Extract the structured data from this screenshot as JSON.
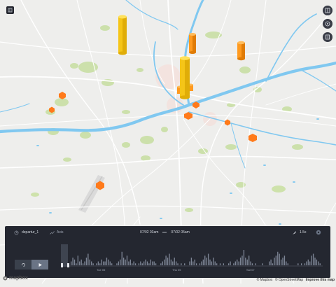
{
  "map": {
    "colors": {
      "land": "#eeeeec",
      "water": "#7cc7ef",
      "park": "#c9dfa4",
      "urban": "#f3d7d2",
      "hex": "#ff7a1a",
      "bar": "#f5c518"
    },
    "columns": [
      {
        "name": "north-tall",
        "height": 0.55,
        "color": "#f5c518"
      },
      {
        "name": "center-tall",
        "height": 0.85,
        "color": "#f5c518"
      },
      {
        "name": "north-short",
        "height": 0.28,
        "color": "#ff9a1f"
      },
      {
        "name": "east",
        "height": 0.25,
        "color": "#ff9a1f"
      },
      {
        "name": "center-small",
        "height": 0.08,
        "color": "#ff9a1f"
      }
    ]
  },
  "controls": {
    "left_icon": "toggle-panel-icon",
    "right_icons": [
      "split-map-icon",
      "layer-visibility-icon",
      "map-legend-icon"
    ]
  },
  "timeline": {
    "filter_field": "departur_1",
    "axis_label": "Axis",
    "range_start": "07/02 03am",
    "range_end": "07/02 05am",
    "speed": "1.5x",
    "ticks": [
      "Tue 05",
      "Thu 05",
      "Sat 07"
    ],
    "loop_icon": "loop-icon",
    "play_icon": "play-icon",
    "histogram": [
      2,
      4,
      3,
      1,
      5,
      2,
      3,
      1,
      2,
      4,
      6,
      3,
      2,
      1,
      0,
      1,
      2,
      1,
      3,
      2,
      2,
      4,
      3,
      2,
      1,
      0,
      0,
      1,
      2,
      3,
      7,
      4,
      3,
      5,
      2,
      3,
      1,
      2,
      1,
      0,
      1,
      2,
      1,
      2,
      3,
      2,
      1,
      3,
      2,
      2,
      1,
      0,
      0,
      1,
      2,
      3,
      5,
      4,
      6,
      3,
      2,
      4,
      2,
      1,
      0,
      1,
      0,
      1,
      0,
      0,
      2,
      4,
      2,
      3,
      1,
      0,
      1,
      2,
      3,
      5,
      4,
      6,
      3,
      2,
      4,
      2,
      1,
      0,
      1,
      0,
      1,
      0,
      0,
      1,
      2,
      0,
      1,
      2,
      3,
      2,
      4,
      5,
      8,
      4,
      3,
      5,
      2,
      1,
      0,
      1,
      0,
      0,
      0,
      1,
      0,
      0,
      0,
      2,
      3,
      1,
      4,
      5,
      7,
      6,
      3,
      4,
      5,
      2,
      1,
      0,
      0,
      0,
      0,
      0,
      1,
      0,
      1,
      0,
      1,
      2,
      3,
      2,
      5,
      6,
      4,
      3,
      2,
      1
    ]
  },
  "footer": {
    "logo": "mapbox",
    "attribution": [
      "© Mapbox",
      "© OpenStreetMap",
      "Improve this map"
    ]
  }
}
